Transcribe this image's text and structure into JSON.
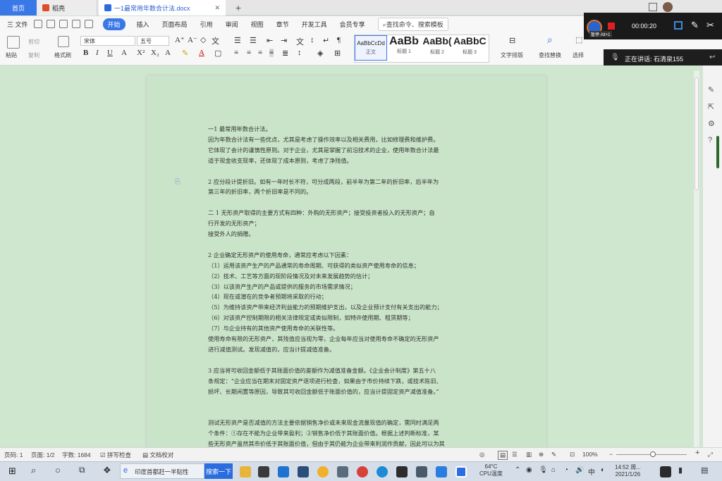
{
  "tabs": {
    "home": "首页",
    "daoke": "稻壳",
    "doc": "一1最常用年数合计法.docx"
  },
  "menu": {
    "file": "三 文件",
    "start": "开始",
    "items": [
      "插入",
      "页面布局",
      "引用",
      "审阅",
      "视图",
      "章节",
      "开发工具",
      "会员专享"
    ],
    "search": "查找命令、搜索模板"
  },
  "ribbon": {
    "paste": "粘贴",
    "cut": "剪切",
    "copy": "复制",
    "format_painter": "格式刷",
    "font_name": "宋体",
    "font_size": "五号",
    "styles": [
      {
        "preview": "AaBbCcDd",
        "label": "正文"
      },
      {
        "preview": "AaBb",
        "label": "标题 1"
      },
      {
        "preview": "AaBb(",
        "label": "标题 2"
      },
      {
        "preview": "AaBbC",
        "label": "标题 3"
      }
    ],
    "text_layout": "文字排版",
    "find_replace": "查找替换",
    "select": "选择"
  },
  "recording": {
    "time": "00:00:20",
    "hint": "暂停 Alt+1",
    "status": "正在讲话: 石清泉155"
  },
  "document": {
    "lines": [
      "一1 最常用年数合计法。",
      "因为年数合计法有一些优点，尤其是考虑了操作效率以及相关费用，比如修理费和维护费。",
      "它体现了会计的谨慎性原则。对于企业，尤其是掌握了前沿技术的企业，使用年数合计法最",
      "适于现金收支现率，还体现了成本原则，考虑了净残值。",
      "",
      "2 应分段计提折旧。如有一年时长不符，可分成两段，前半年为第二年的折旧率，后半年为",
      "第三年的折旧率，两个折旧率是不同的。",
      "",
      "二 1 无形资产取得的主要方式有四种：外购的无形资产；接受投资者投入的无形资产；自",
      "行开发的无形资产；",
      "接受外人的捐赠。",
      "",
      "2 企业确定无形资产的使用寿命，通常应考虑以下因素：",
      "（1）运用该资产生产的产品通常的寿命周期、可获得的类似资产使用寿命的信息；",
      "（2）技术、工艺等方面的现阶段情况及对未来发展趋势的估计；",
      "（3）以该资产生产的产品或提供的服务的市场需求情况；",
      "（4）现在或潜在的竞争者预期将采取的行动；",
      "（5）为维持该资产带来经济利益能力的预期维护支出，以及企业预计支付有关支出的能力；",
      "（6）对该资产控制期限的相关法律规定或类似限制，如特许使用期、租赁期等；",
      "（7）与企业持有的其他资产使用寿命的关联性等。",
      "使用寿命有限的无形资产，其残值应当视为零，企业每年应当对使用寿命不确定的无形资产",
      "进行减值测试。发现减值的，应当计提减值准备。",
      "",
      "3 应当将可收回金额低于其账面价值的差额作为减值准备金额。《企业会计制度》第五十八",
      "条规定：“企业应当在期末对固定资产逐项进行检查，如果由于市价持续下跌，或技术陈旧、",
      "损坏、长期闲置等原因，导致其可收回金额低于账面价值的，应当计提固定资产减值准备。”",
      "",
      "",
      "测试无形资产是否减值的方法主要依据销售净价或未来现金流量现值的确定，需同时满足两",
      "个条件：①存在不能为企业带来盈利；②销售净价低于其账面价值。根据上述判断标准，某",
      "些无形资产虽然其市价低于其账面价值，但由于其仍能为企业带来利润作贡献，因此可以为其"
    ]
  },
  "status": {
    "pages": "页码: 1",
    "page_of": "页面: 1/2",
    "words": "字数: 1684",
    "spell": "拼写检查",
    "proof": "文档校对",
    "zoom": "100%"
  },
  "taskbar": {
    "search_text": "印度首都赶一半贴性",
    "search_btn": "搜索一下",
    "weather_temp": "64°C",
    "weather_label": "CPU温度",
    "time": "14:52 周...",
    "date": "2021/1/26"
  }
}
